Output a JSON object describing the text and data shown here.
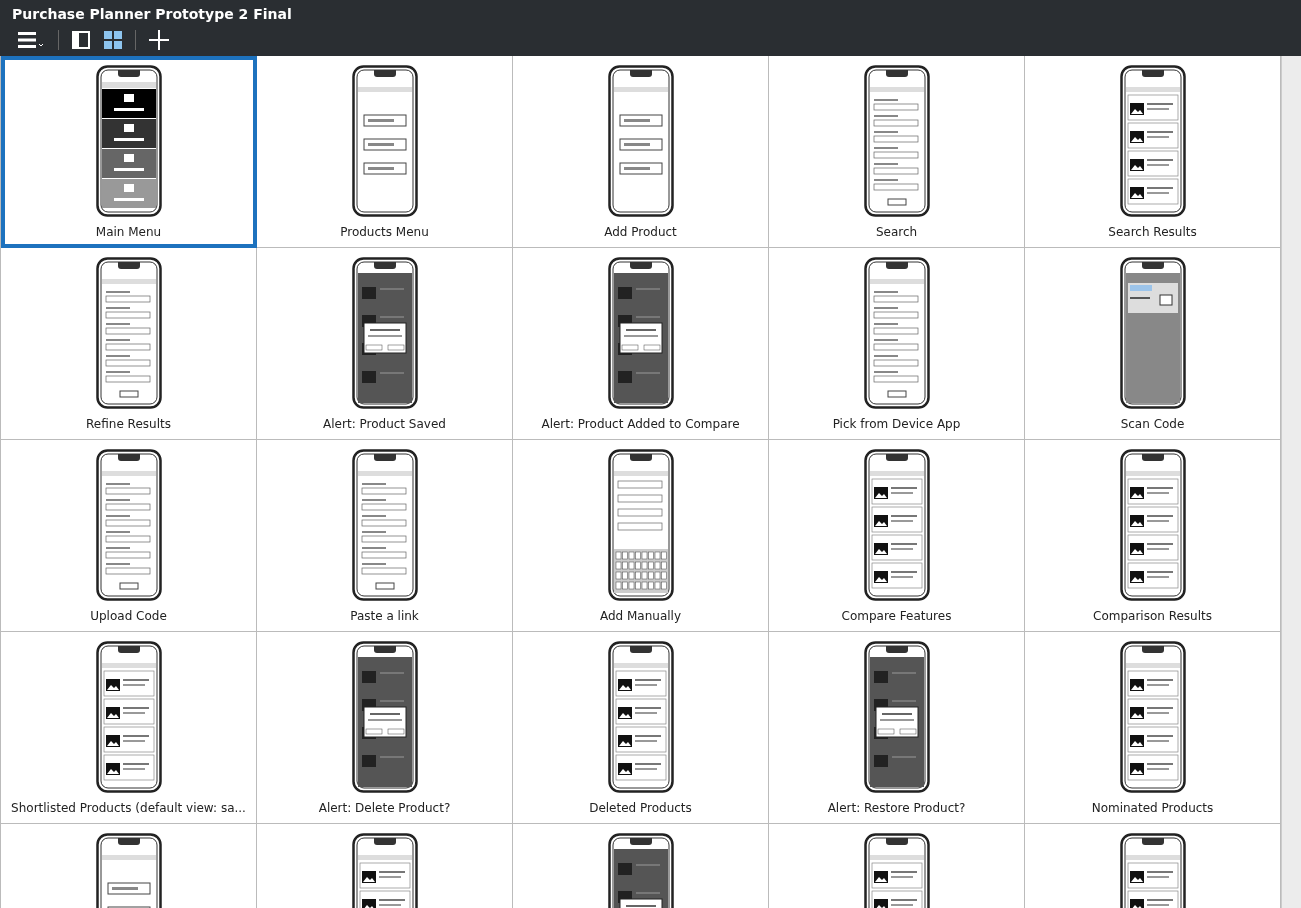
{
  "window": {
    "title": "Purchase Planner Prototype 2 Final"
  },
  "toolbar": {
    "view_buttons": [
      {
        "kind": "single",
        "selected": false
      },
      {
        "kind": "grid",
        "selected": true
      }
    ]
  },
  "screens": [
    {
      "label": "Main Menu",
      "selected": true,
      "kind": "menu"
    },
    {
      "label": "Products Menu",
      "selected": false,
      "kind": "buttons"
    },
    {
      "label": "Add Product",
      "selected": false,
      "kind": "buttons"
    },
    {
      "label": "Search",
      "selected": false,
      "kind": "form"
    },
    {
      "label": "Search Results",
      "selected": false,
      "kind": "list"
    },
    {
      "label": "Refine Results",
      "selected": false,
      "kind": "form"
    },
    {
      "label": "Alert: Product Saved",
      "selected": false,
      "kind": "dialog"
    },
    {
      "label": "Alert: Product Added to Compare",
      "selected": false,
      "kind": "dialog"
    },
    {
      "label": "Pick from Device App",
      "selected": false,
      "kind": "form"
    },
    {
      "label": "Scan Code",
      "selected": false,
      "kind": "gray"
    },
    {
      "label": "Upload Code",
      "selected": false,
      "kind": "form"
    },
    {
      "label": "Paste a link",
      "selected": false,
      "kind": "form"
    },
    {
      "label": "Add Manually",
      "selected": false,
      "kind": "keyboard"
    },
    {
      "label": "Compare Features",
      "selected": false,
      "kind": "list"
    },
    {
      "label": "Comparison Results",
      "selected": false,
      "kind": "list"
    },
    {
      "label": "Shortlisted Products (default view: sa...",
      "selected": false,
      "kind": "list"
    },
    {
      "label": "Alert: Delete Product?",
      "selected": false,
      "kind": "dialog"
    },
    {
      "label": "Deleted Products",
      "selected": false,
      "kind": "list"
    },
    {
      "label": "Alert: Restore Product?",
      "selected": false,
      "kind": "dialog"
    },
    {
      "label": "Nominated Products",
      "selected": false,
      "kind": "list"
    },
    {
      "selected": false,
      "kind": "buttons"
    },
    {
      "selected": false,
      "kind": "list"
    },
    {
      "selected": false,
      "kind": "dialog"
    },
    {
      "selected": false,
      "kind": "list"
    },
    {
      "selected": false,
      "kind": "list"
    }
  ]
}
